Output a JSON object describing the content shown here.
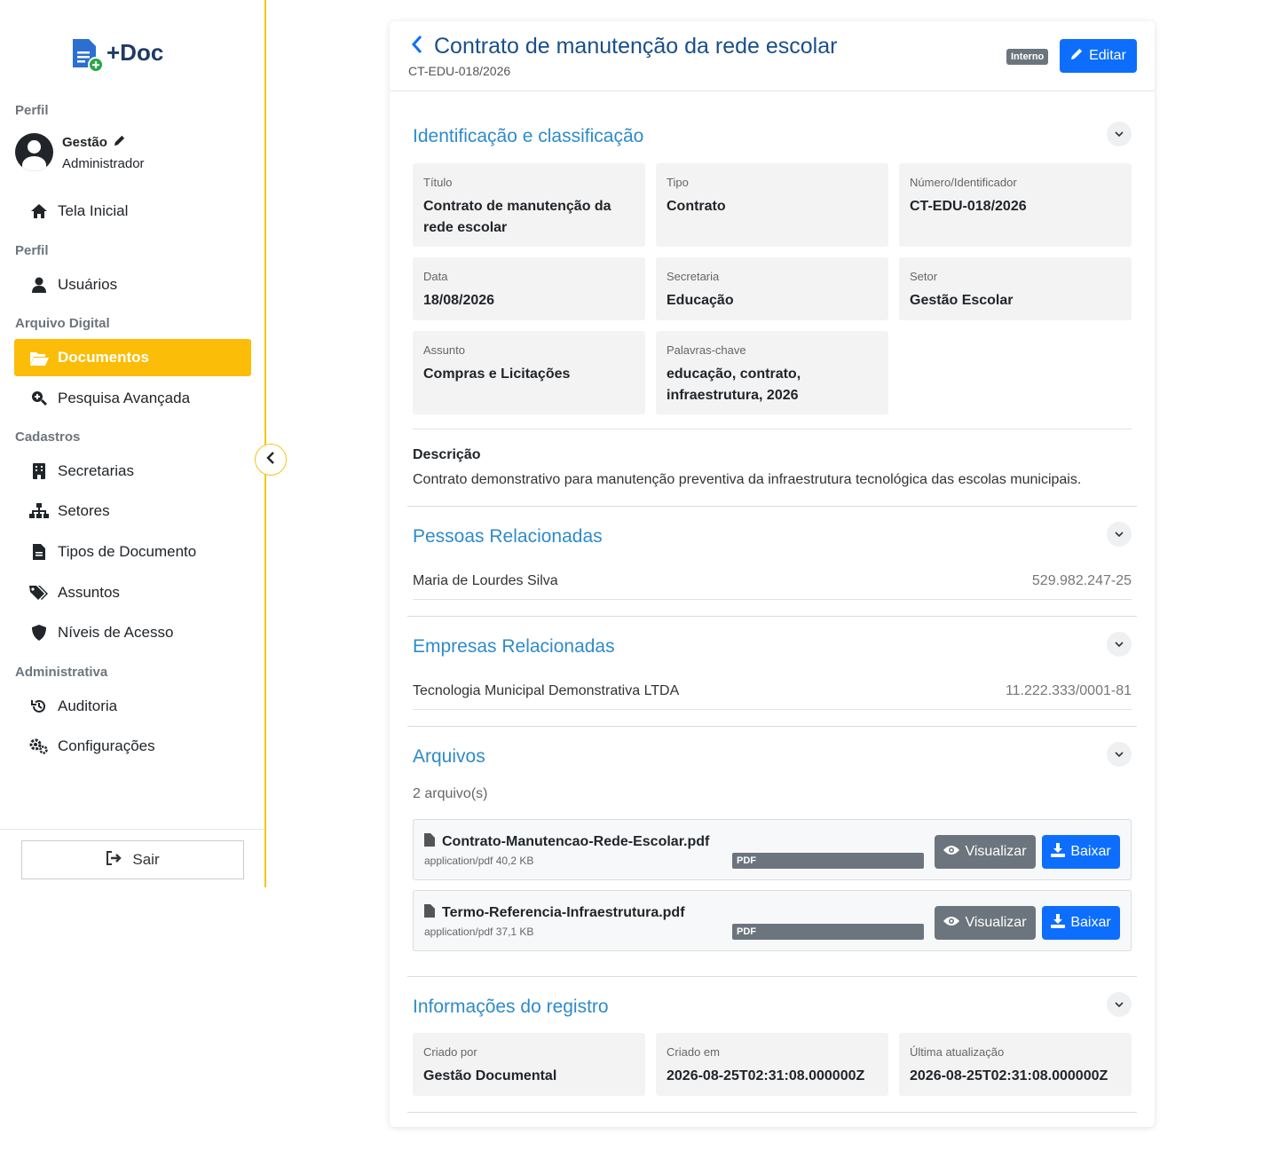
{
  "app": {
    "logo_text": "+Doc"
  },
  "sidebar": {
    "profile_label": "Perfil",
    "user_name": "Gestão",
    "user_role": "Administrador",
    "home": "Tela Inicial",
    "perfil_label": "Perfil",
    "users": "Usuários",
    "archive_label": "Arquivo Digital",
    "documents": "Documentos",
    "advanced_search": "Pesquisa Avançada",
    "registries_label": "Cadastros",
    "departments": "Secretarias",
    "sectors": "Setores",
    "doc_types": "Tipos de Documento",
    "subjects": "Assuntos",
    "access_levels": "Níveis de Acesso",
    "admin_label": "Administrativa",
    "audit": "Auditoria",
    "settings": "Configurações",
    "logout": "Sair",
    "accent_color": "#fbbd08"
  },
  "header": {
    "title": "Contrato de manutenção da rede escolar",
    "code": "CT-EDU-018/2026",
    "badge": "Interno",
    "edit": "Editar"
  },
  "identification": {
    "title": "Identificação e classificação",
    "fields": [
      {
        "label": "Título",
        "value": "Contrato de manutenção da rede escolar"
      },
      {
        "label": "Tipo",
        "value": "Contrato"
      },
      {
        "label": "Número/Identificador",
        "value": "CT-EDU-018/2026"
      },
      {
        "label": "Data",
        "value": "18/08/2026"
      },
      {
        "label": "Secretaria",
        "value": "Educação"
      },
      {
        "label": "Setor",
        "value": "Gestão Escolar"
      },
      {
        "label": "Assunto",
        "value": "Compras e Licitações"
      },
      {
        "label": "Palavras-chave",
        "value": "educação, contrato, infraestrutura, 2026"
      }
    ],
    "description_label": "Descrição",
    "description": "Contrato demonstrativo para manutenção preventiva da infraestrutura tecnológica das escolas municipais."
  },
  "people": {
    "title": "Pessoas Relacionadas",
    "items": [
      {
        "name": "Maria de Lourdes Silva",
        "doc": "529.982.247-25"
      }
    ]
  },
  "companies": {
    "title": "Empresas Relacionadas",
    "items": [
      {
        "name": "Tecnologia Municipal Demonstrativa LTDA",
        "doc": "11.222.333/0001-81"
      }
    ]
  },
  "files": {
    "title": "Arquivos",
    "count": "2 arquivo(s)",
    "view": "Visualizar",
    "download": "Baixar",
    "items": [
      {
        "name": "Contrato-Manutencao-Rede-Escolar.pdf",
        "meta": "application/pdf 40,2 KB",
        "tag": "PDF"
      },
      {
        "name": "Termo-Referencia-Infraestrutura.pdf",
        "meta": "application/pdf 37,1 KB",
        "tag": "PDF"
      }
    ]
  },
  "record": {
    "title": "Informações do registro",
    "fields": [
      {
        "label": "Criado por",
        "value": "Gestão Documental"
      },
      {
        "label": "Criado em",
        "value": "2026-08-25T02:31:08.000000Z"
      },
      {
        "label": "Última atualização",
        "value": "2026-08-25T02:31:08.000000Z"
      }
    ]
  }
}
